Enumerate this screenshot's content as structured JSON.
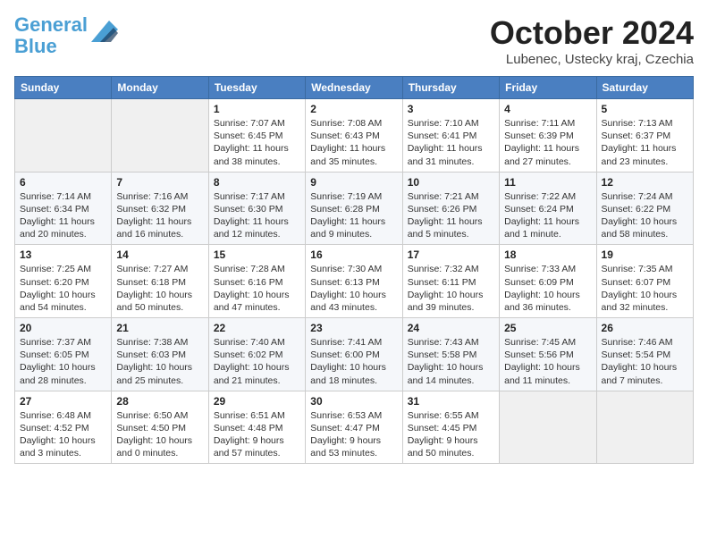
{
  "logo": {
    "line1": "General",
    "line2": "Blue"
  },
  "title": "October 2024",
  "subtitle": "Lubenec, Ustecky kraj, Czechia",
  "weekdays": [
    "Sunday",
    "Monday",
    "Tuesday",
    "Wednesday",
    "Thursday",
    "Friday",
    "Saturday"
  ],
  "weeks": [
    [
      {
        "day": "",
        "info": ""
      },
      {
        "day": "",
        "info": ""
      },
      {
        "day": "1",
        "info": "Sunrise: 7:07 AM\nSunset: 6:45 PM\nDaylight: 11 hours\nand 38 minutes."
      },
      {
        "day": "2",
        "info": "Sunrise: 7:08 AM\nSunset: 6:43 PM\nDaylight: 11 hours\nand 35 minutes."
      },
      {
        "day": "3",
        "info": "Sunrise: 7:10 AM\nSunset: 6:41 PM\nDaylight: 11 hours\nand 31 minutes."
      },
      {
        "day": "4",
        "info": "Sunrise: 7:11 AM\nSunset: 6:39 PM\nDaylight: 11 hours\nand 27 minutes."
      },
      {
        "day": "5",
        "info": "Sunrise: 7:13 AM\nSunset: 6:37 PM\nDaylight: 11 hours\nand 23 minutes."
      }
    ],
    [
      {
        "day": "6",
        "info": "Sunrise: 7:14 AM\nSunset: 6:34 PM\nDaylight: 11 hours\nand 20 minutes."
      },
      {
        "day": "7",
        "info": "Sunrise: 7:16 AM\nSunset: 6:32 PM\nDaylight: 11 hours\nand 16 minutes."
      },
      {
        "day": "8",
        "info": "Sunrise: 7:17 AM\nSunset: 6:30 PM\nDaylight: 11 hours\nand 12 minutes."
      },
      {
        "day": "9",
        "info": "Sunrise: 7:19 AM\nSunset: 6:28 PM\nDaylight: 11 hours\nand 9 minutes."
      },
      {
        "day": "10",
        "info": "Sunrise: 7:21 AM\nSunset: 6:26 PM\nDaylight: 11 hours\nand 5 minutes."
      },
      {
        "day": "11",
        "info": "Sunrise: 7:22 AM\nSunset: 6:24 PM\nDaylight: 11 hours\nand 1 minute."
      },
      {
        "day": "12",
        "info": "Sunrise: 7:24 AM\nSunset: 6:22 PM\nDaylight: 10 hours\nand 58 minutes."
      }
    ],
    [
      {
        "day": "13",
        "info": "Sunrise: 7:25 AM\nSunset: 6:20 PM\nDaylight: 10 hours\nand 54 minutes."
      },
      {
        "day": "14",
        "info": "Sunrise: 7:27 AM\nSunset: 6:18 PM\nDaylight: 10 hours\nand 50 minutes."
      },
      {
        "day": "15",
        "info": "Sunrise: 7:28 AM\nSunset: 6:16 PM\nDaylight: 10 hours\nand 47 minutes."
      },
      {
        "day": "16",
        "info": "Sunrise: 7:30 AM\nSunset: 6:13 PM\nDaylight: 10 hours\nand 43 minutes."
      },
      {
        "day": "17",
        "info": "Sunrise: 7:32 AM\nSunset: 6:11 PM\nDaylight: 10 hours\nand 39 minutes."
      },
      {
        "day": "18",
        "info": "Sunrise: 7:33 AM\nSunset: 6:09 PM\nDaylight: 10 hours\nand 36 minutes."
      },
      {
        "day": "19",
        "info": "Sunrise: 7:35 AM\nSunset: 6:07 PM\nDaylight: 10 hours\nand 32 minutes."
      }
    ],
    [
      {
        "day": "20",
        "info": "Sunrise: 7:37 AM\nSunset: 6:05 PM\nDaylight: 10 hours\nand 28 minutes."
      },
      {
        "day": "21",
        "info": "Sunrise: 7:38 AM\nSunset: 6:03 PM\nDaylight: 10 hours\nand 25 minutes."
      },
      {
        "day": "22",
        "info": "Sunrise: 7:40 AM\nSunset: 6:02 PM\nDaylight: 10 hours\nand 21 minutes."
      },
      {
        "day": "23",
        "info": "Sunrise: 7:41 AM\nSunset: 6:00 PM\nDaylight: 10 hours\nand 18 minutes."
      },
      {
        "day": "24",
        "info": "Sunrise: 7:43 AM\nSunset: 5:58 PM\nDaylight: 10 hours\nand 14 minutes."
      },
      {
        "day": "25",
        "info": "Sunrise: 7:45 AM\nSunset: 5:56 PM\nDaylight: 10 hours\nand 11 minutes."
      },
      {
        "day": "26",
        "info": "Sunrise: 7:46 AM\nSunset: 5:54 PM\nDaylight: 10 hours\nand 7 minutes."
      }
    ],
    [
      {
        "day": "27",
        "info": "Sunrise: 6:48 AM\nSunset: 4:52 PM\nDaylight: 10 hours\nand 3 minutes."
      },
      {
        "day": "28",
        "info": "Sunrise: 6:50 AM\nSunset: 4:50 PM\nDaylight: 10 hours\nand 0 minutes."
      },
      {
        "day": "29",
        "info": "Sunrise: 6:51 AM\nSunset: 4:48 PM\nDaylight: 9 hours\nand 57 minutes."
      },
      {
        "day": "30",
        "info": "Sunrise: 6:53 AM\nSunset: 4:47 PM\nDaylight: 9 hours\nand 53 minutes."
      },
      {
        "day": "31",
        "info": "Sunrise: 6:55 AM\nSunset: 4:45 PM\nDaylight: 9 hours\nand 50 minutes."
      },
      {
        "day": "",
        "info": ""
      },
      {
        "day": "",
        "info": ""
      }
    ]
  ]
}
